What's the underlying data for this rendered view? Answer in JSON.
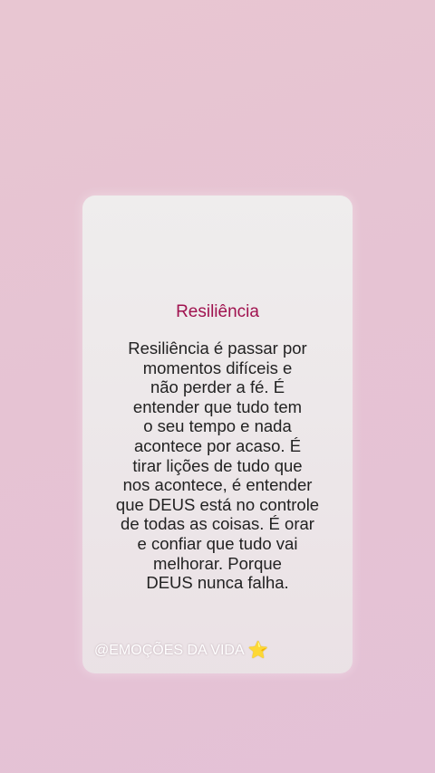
{
  "card": {
    "title": "Resiliência",
    "body": "Resiliência é passar por\nmomentos difíceis e\nnão perder a fé. É\nentender que tudo tem\no seu tempo e nada\nacontece por acaso. É\ntirar lições de tudo que\nnos acontece, é entender\nque DEUS está no controle\nde todas as coisas. É orar\ne confiar que tudo vai\nmelhorar. Porque\nDEUS nunca falha."
  },
  "footer": {
    "handle": "@EMOÇÕES DA VIDA",
    "star": "⭐"
  }
}
